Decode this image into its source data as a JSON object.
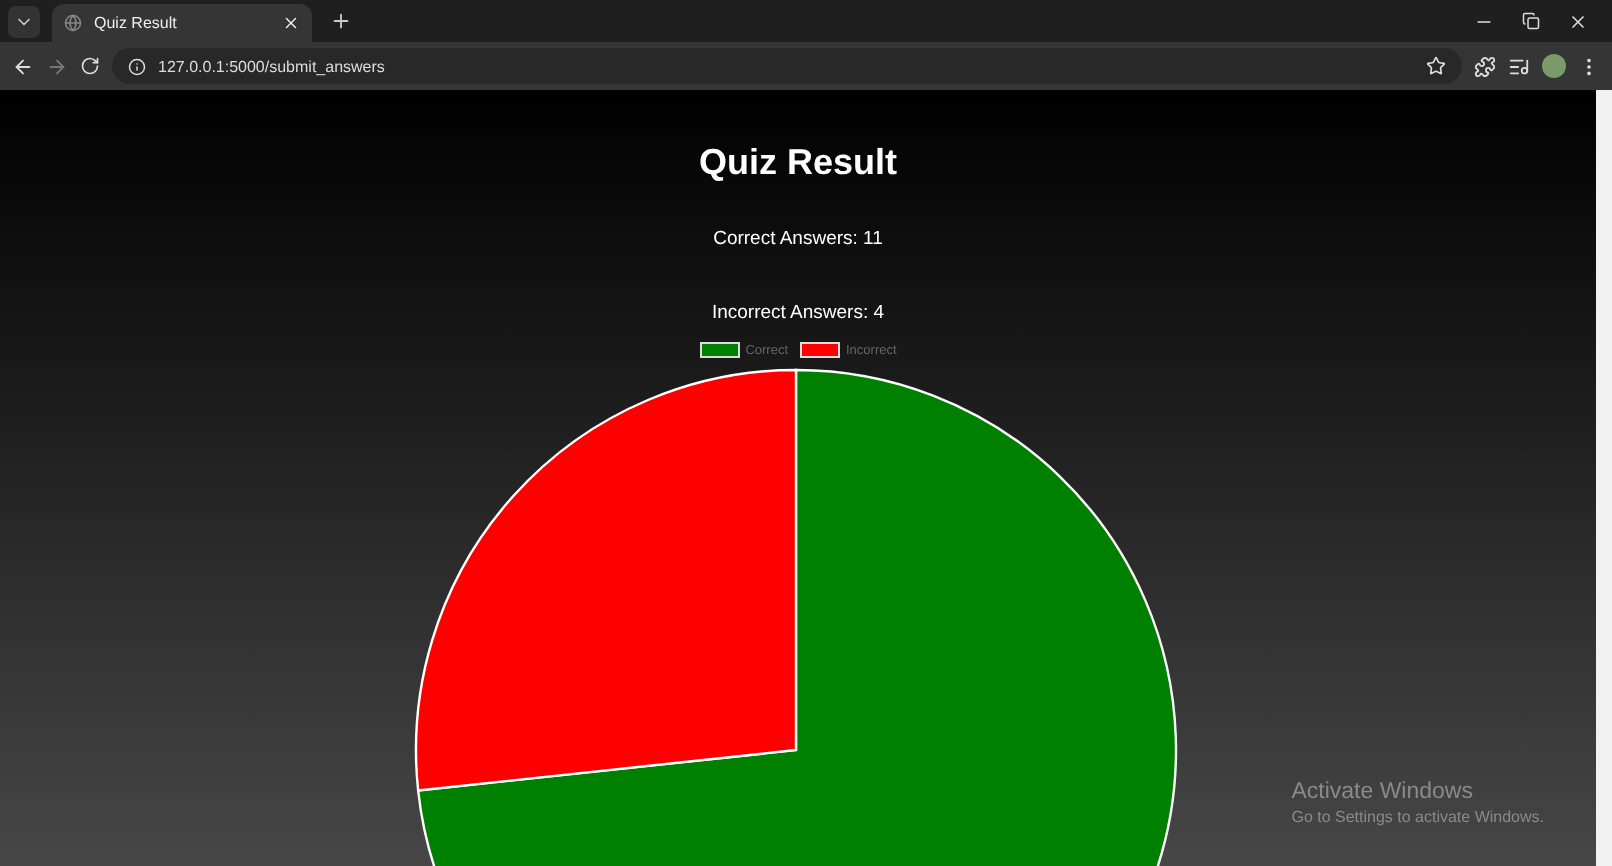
{
  "browser": {
    "tab_title": "Quiz Result",
    "url": "127.0.0.1:5000/submit_answers"
  },
  "page": {
    "title": "Quiz Result",
    "lines": [
      "Correct Answers: 11",
      "Incorrect Answers: 4"
    ],
    "chart_data": {
      "type": "pie",
      "categories": [
        "Correct",
        "Incorrect"
      ],
      "series": [
        {
          "values": [
            73.3,
            26.7
          ]
        }
      ],
      "colors": [
        "#008000",
        "#ff0000"
      ]
    }
  },
  "os_notice": {
    "title": "Activate Windows",
    "text": "Go to Settings to activate Windows."
  }
}
